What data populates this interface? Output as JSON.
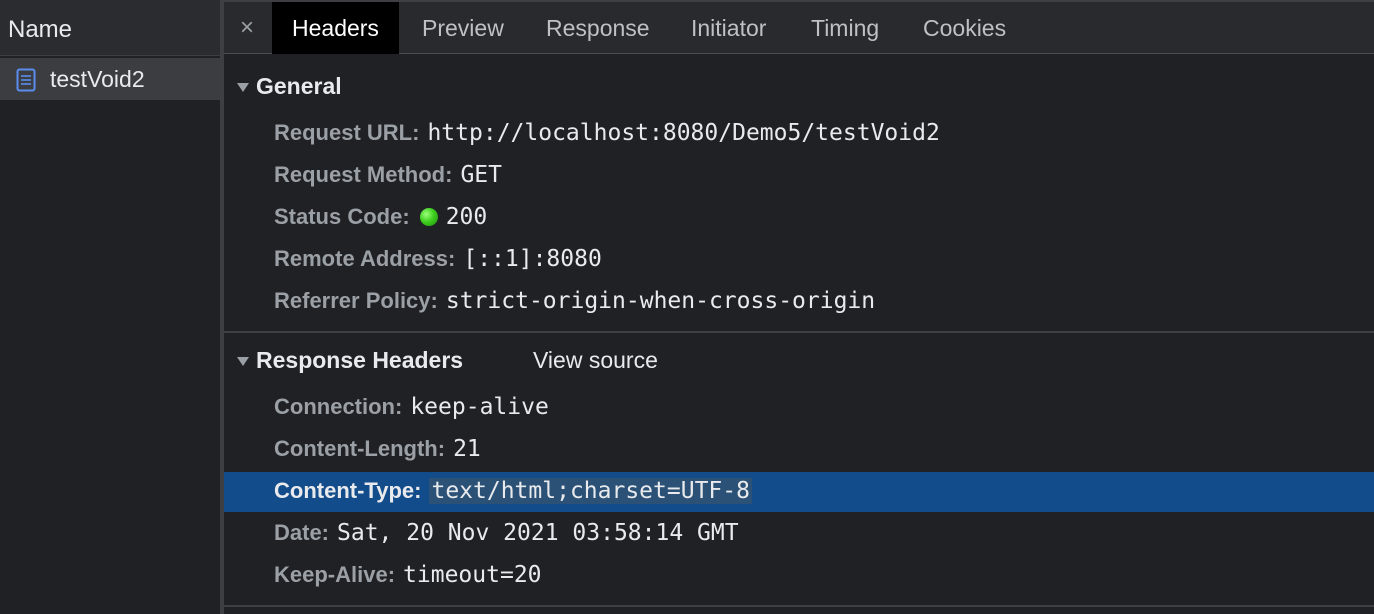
{
  "left_panel": {
    "header": "Name",
    "requests": [
      {
        "name": "testVoid2",
        "icon": "document-icon"
      }
    ]
  },
  "tabs": {
    "close_symbol": "×",
    "items": [
      "Headers",
      "Preview",
      "Response",
      "Initiator",
      "Timing",
      "Cookies"
    ],
    "active": "Headers"
  },
  "general": {
    "title": "General",
    "rows": [
      {
        "key": "Request URL:",
        "value": "http://localhost:8080/Demo5/testVoid2"
      },
      {
        "key": "Request Method:",
        "value": "GET"
      },
      {
        "key": "Status Code:",
        "value": "200",
        "status_color": "#34c21a"
      },
      {
        "key": "Remote Address:",
        "value": "[::1]:8080"
      },
      {
        "key": "Referrer Policy:",
        "value": "strict-origin-when-cross-origin"
      }
    ]
  },
  "response_headers": {
    "title": "Response Headers",
    "view_source": "View source",
    "rows": [
      {
        "key": "Connection:",
        "value": "keep-alive"
      },
      {
        "key": "Content-Length:",
        "value": "21"
      },
      {
        "key": "Content-Type:",
        "value": "text/html;charset=UTF-8"
      },
      {
        "key": "Date:",
        "value": "Sat, 20 Nov 2021 03:58:14 GMT"
      },
      {
        "key": "Keep-Alive:",
        "value": "timeout=20"
      }
    ],
    "selected_row": "Content-Type:"
  },
  "colors": {
    "background": "#202124",
    "selection": "#134c8a",
    "key_text": "#9aa0a6",
    "value_text": "#e8eaed"
  }
}
